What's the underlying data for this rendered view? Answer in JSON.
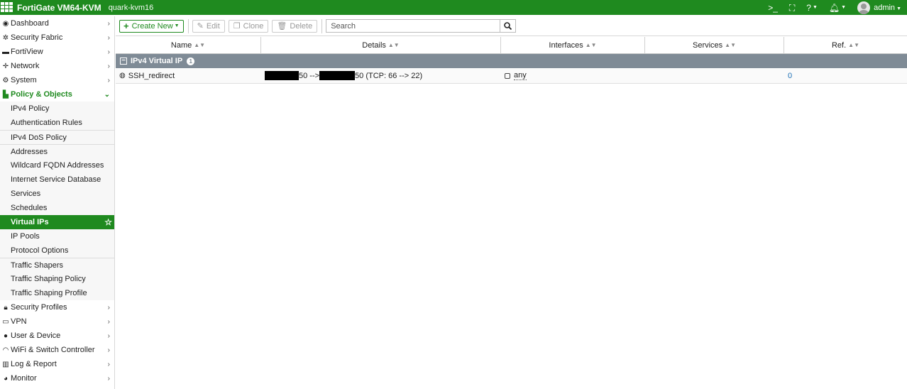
{
  "header": {
    "brand": "FortiGate VM64-KVM",
    "hostname": "quark-kvm16",
    "user": "admin",
    "icons": [
      "cli-icon",
      "fullscreen-icon",
      "help-icon",
      "bell-icon",
      "avatar"
    ]
  },
  "colors": {
    "accent": "#1f8a1f",
    "group_header": "#7f8b96",
    "link": "#1b6fb5"
  },
  "sidebar": {
    "items": [
      {
        "label": "Dashboard",
        "icon": "dashboard-icon"
      },
      {
        "label": "Security Fabric",
        "icon": "fabric-icon"
      },
      {
        "label": "FortiView",
        "icon": "fortiview-icon"
      },
      {
        "label": "Network",
        "icon": "network-icon"
      },
      {
        "label": "System",
        "icon": "gear-icon"
      },
      {
        "label": "Policy & Objects",
        "icon": "policy-icon"
      }
    ],
    "policy_subitems": [
      "IPv4 Policy",
      "Authentication Rules",
      "IPv4 DoS Policy",
      "Addresses",
      "Wildcard FQDN Addresses",
      "Internet Service Database",
      "Services",
      "Schedules",
      "Virtual IPs",
      "IP Pools",
      "Protocol Options",
      "Traffic Shapers",
      "Traffic Shaping Policy",
      "Traffic Shaping Profile"
    ],
    "bottom_items": [
      {
        "label": "Security Profiles",
        "icon": "lock-icon"
      },
      {
        "label": "VPN",
        "icon": "laptop-icon"
      },
      {
        "label": "User & Device",
        "icon": "user-icon"
      },
      {
        "label": "WiFi & Switch Controller",
        "icon": "wifi-icon"
      },
      {
        "label": "Log & Report",
        "icon": "chart-icon"
      },
      {
        "label": "Monitor",
        "icon": "pie-icon"
      }
    ]
  },
  "toolbar": {
    "create_new": "Create New",
    "edit": "Edit",
    "clone": "Clone",
    "delete": "Delete",
    "search_placeholder": "Search"
  },
  "table": {
    "columns": [
      "Name",
      "Details",
      "Interfaces",
      "Services",
      "Ref."
    ],
    "group": {
      "label": "IPv4 Virtual IP",
      "count": "1"
    },
    "rows": [
      {
        "name": "SSH_redirect",
        "details_a": "50 -->",
        "details_b": "50 (TCP: 66 --> 22)",
        "interface": "any",
        "services": "",
        "ref": "0"
      }
    ]
  }
}
